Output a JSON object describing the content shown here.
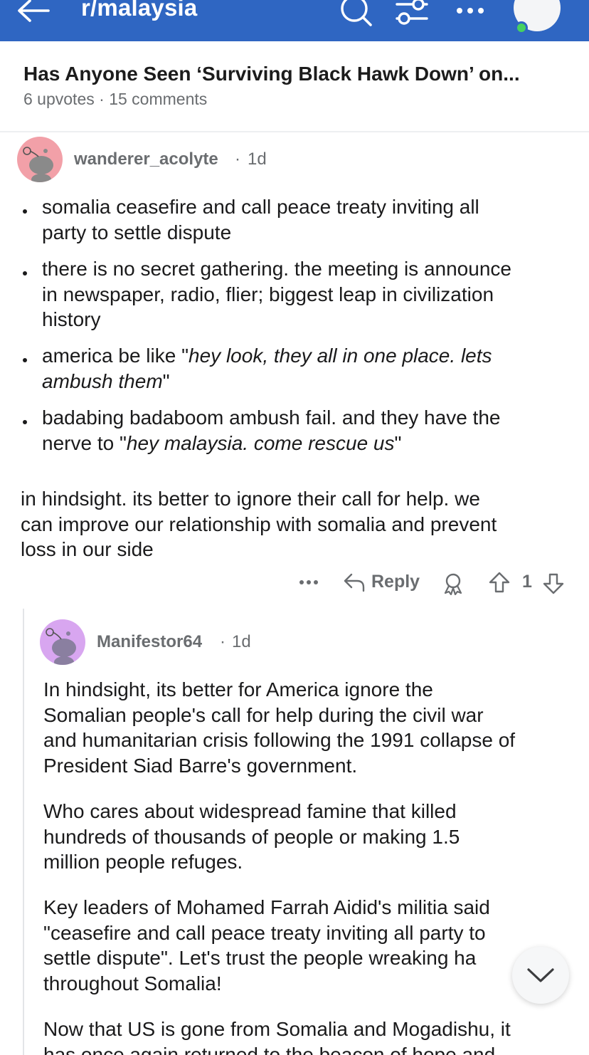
{
  "header": {
    "subreddit": "r/malaysia",
    "icons": [
      "back-arrow-icon",
      "search-icon",
      "filter-icon",
      "more-icon",
      "user-avatar"
    ],
    "colors": {
      "bar": "#2f66c2",
      "text": "#ffffff",
      "online": "#46d160"
    }
  },
  "post": {
    "title": "Has Anyone Seen ‘Surviving Black Hawk Down’ on...",
    "upvotes": "6 upvotes",
    "comments": "15 comments"
  },
  "comment1": {
    "author": "wanderer_acolyte",
    "age": "1d",
    "avatar_color": "#f2a0a8",
    "bullets": [
      {
        "line1": "somalia ceasefire and call peace treaty inviting all",
        "line2": "party to settle dispute"
      },
      {
        "line1": "there is no secret gathering. the meeting is announce",
        "line2": "in newspaper, radio, flier; biggest leap in civilization",
        "line3": "history"
      },
      {
        "line1_plain": "america be like \"",
        "line1_italic": "hey look, they all in one place. lets",
        "line2_italic": "ambush them",
        "line2_plain": "\""
      },
      {
        "line1": "badabing badaboom ambush fail. and they have the",
        "line2_plain": "nerve to \"",
        "line2_italic": "hey malaysia. come rescue us",
        "line2_end": "\""
      }
    ],
    "paragraph": [
      "in hindsight. its better to ignore their call for help. we",
      "can improve our relationship with somalia and prevent",
      "loss in our side"
    ],
    "actions": {
      "reply": "Reply",
      "score": "1"
    }
  },
  "comment2": {
    "author": "Manifestor64",
    "age": "1d",
    "avatar_color": "#d8a6f0",
    "p1": [
      "In hindsight, its better for America ignore the",
      "Somalian people's call for help during the civil war",
      "and humanitarian crisis following the 1991 collapse of",
      "President Siad Barre's government."
    ],
    "p2": [
      "Who cares about widespread famine that killed",
      "hundreds of thousands of people or making 1.5",
      "million people refuges."
    ],
    "p3": [
      "Key leaders of Mohamed Farrah Aidid's militia said",
      "\"ceasefire and call peace treaty inviting all party to",
      "settle dispute\". Let's trust the people wreaking ha",
      "throughout Somalia!"
    ],
    "p4": [
      "Now that US is gone from Somalia and Mogadishu, it",
      "has once again returned to the beacon of hope and"
    ]
  }
}
